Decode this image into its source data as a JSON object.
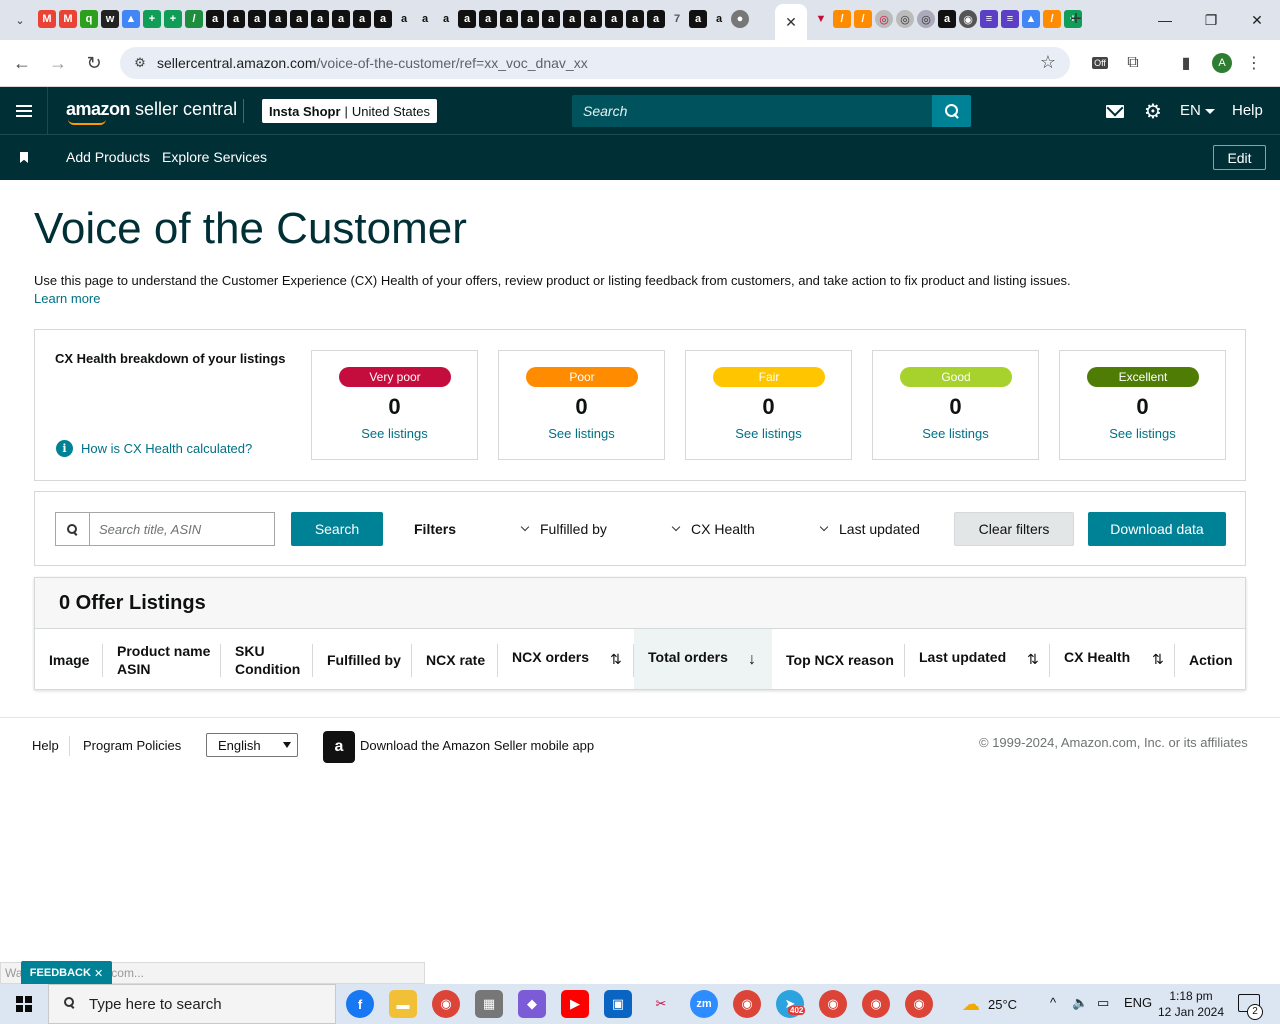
{
  "browser": {
    "url_host": "sellercentral.amazon.com",
    "url_path": "/voice-of-the-customer/ref=xx_voc_dnav_xx",
    "active_tab_close": "✕",
    "new_tab": "+",
    "profile_initial": "A",
    "extension_badge": "Off"
  },
  "header": {
    "logo_brand": "amazon",
    "logo_product": "seller central",
    "store_name": "Insta Shopr",
    "store_separator": "|",
    "store_region": "United States",
    "search_placeholder": "Search",
    "language": "EN",
    "help": "Help"
  },
  "subnav": {
    "links": [
      "Add Products",
      "Explore Services"
    ],
    "edit": "Edit"
  },
  "page": {
    "title": "Voice of the Customer",
    "description": "Use this page to understand the Customer Experience (CX) Health of your offers, review product or listing feedback from customers, and take action to fix product and listing issues.",
    "learn_more": "Learn more"
  },
  "cx_health": {
    "title": "CX Health breakdown of your listings",
    "how_calculated": "How is CX Health calculated?",
    "info_glyph": "i",
    "cards": [
      {
        "label": "Very poor",
        "count": "0",
        "link": "See listings",
        "color": "#c40d3c",
        "text_color": "#ffffff"
      },
      {
        "label": "Poor",
        "count": "0",
        "link": "See listings",
        "color": "#ff8c00",
        "text_color": "#ffffff"
      },
      {
        "label": "Fair",
        "count": "0",
        "link": "See listings",
        "color": "#ffc600",
        "text_color": "#ffffff"
      },
      {
        "label": "Good",
        "count": "0",
        "link": "See listings",
        "color": "#a7d12c",
        "text_color": "#ffffff"
      },
      {
        "label": "Excellent",
        "count": "0",
        "link": "See listings",
        "color": "#4f7c04",
        "text_color": "#ffffff"
      }
    ]
  },
  "filters": {
    "search_placeholder": "Search title, ASIN",
    "search_button": "Search",
    "filters_label": "Filters",
    "dropdowns": [
      "Fulfilled by",
      "CX Health",
      "Last updated"
    ],
    "clear": "Clear filters",
    "download": "Download data"
  },
  "listings": {
    "title": "0 Offer Listings",
    "columns": {
      "image": "Image",
      "product_name": "Product name",
      "asin": "ASIN",
      "sku": "SKU",
      "condition": "Condition",
      "fulfilled_by": "Fulfilled by",
      "ncx_rate": "NCX rate",
      "ncx_orders": "NCX orders",
      "total_orders": "Total orders",
      "top_ncx_reason": "Top NCX reason",
      "last_updated": "Last updated",
      "cx_health": "CX Health",
      "action": "Action"
    },
    "sort_both": "⇅",
    "sort_desc": "↓"
  },
  "footer": {
    "help": "Help",
    "program_policies": "Program Policies",
    "language_select": "English",
    "app_promo": "Download the Amazon Seller mobile app",
    "copyright": "© 1999-2024, Amazon.com, Inc. or its affiliates"
  },
  "overlay": {
    "status_text": "Waiting for amazon.com...",
    "feedback": "FEEDBACK",
    "feedback_close": "✕"
  },
  "taskbar": {
    "search_placeholder": "Type here to search",
    "weather_temp": "25°C",
    "input_lang": "ENG",
    "time": "1:18 pm",
    "date": "12 Jan 2024",
    "notifications": "2",
    "telegram_badge": "402"
  },
  "colors": {
    "header_bg": "#002f36",
    "accent_teal": "#008296",
    "link": "#007185"
  }
}
